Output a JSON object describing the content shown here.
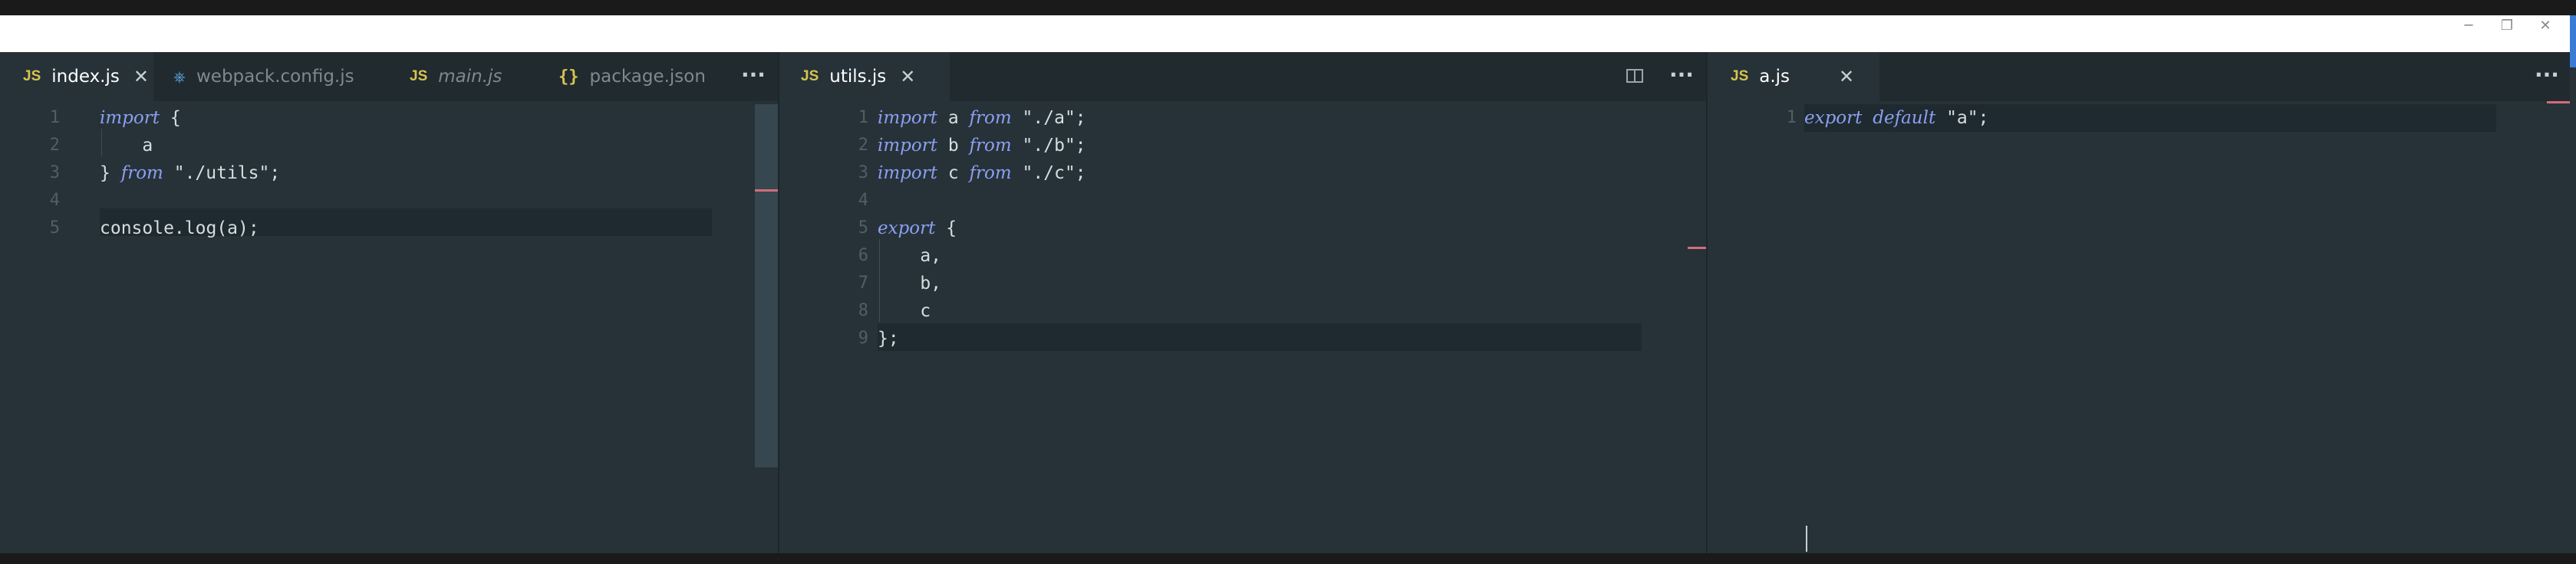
{
  "window": {
    "minimize_glyph": "─",
    "maximize_glyph": "❐",
    "close_glyph": "✕"
  },
  "groups": [
    {
      "tabs": [
        {
          "icon": "JS",
          "label": "index.js",
          "close": "✕",
          "active": true
        },
        {
          "icon": "⎈",
          "label": "webpack.config.js"
        },
        {
          "icon": "JS",
          "label": "main.js",
          "italic": true
        },
        {
          "icon": "{}",
          "label": "package.json"
        }
      ],
      "more": "···",
      "lines": [
        {
          "n": "1",
          "tokens": [
            [
              "kw",
              "import"
            ],
            [
              "pun",
              " {"
            ]
          ]
        },
        {
          "n": "2",
          "tokens": [
            [
              "id",
              "    a"
            ]
          ]
        },
        {
          "n": "3",
          "tokens": [
            [
              "pun",
              "} "
            ],
            [
              "kw",
              "from"
            ],
            [
              "str",
              " \"./utils\""
            ],
            [
              "pun",
              ";"
            ]
          ]
        },
        {
          "n": "4",
          "tokens": []
        },
        {
          "n": "5",
          "tokens": [
            [
              "id",
              "console.log(a)"
            ],
            [
              "pun",
              ";"
            ]
          ]
        }
      ]
    },
    {
      "tabs": [
        {
          "icon": "JS",
          "label": "utils.js",
          "close": "✕",
          "active": true
        }
      ],
      "more": "···",
      "lines": [
        {
          "n": "1",
          "tokens": [
            [
              "kw",
              "import"
            ],
            [
              "id",
              " a "
            ],
            [
              "kw",
              "from"
            ],
            [
              "str",
              " \"./a\""
            ],
            [
              "pun",
              ";"
            ]
          ]
        },
        {
          "n": "2",
          "tokens": [
            [
              "kw",
              "import"
            ],
            [
              "id",
              " b "
            ],
            [
              "kw",
              "from"
            ],
            [
              "str",
              " \"./b\""
            ],
            [
              "pun",
              ";"
            ]
          ]
        },
        {
          "n": "3",
          "tokens": [
            [
              "kw",
              "import"
            ],
            [
              "id",
              " c "
            ],
            [
              "kw",
              "from"
            ],
            [
              "str",
              " \"./c\""
            ],
            [
              "pun",
              ";"
            ]
          ]
        },
        {
          "n": "4",
          "tokens": []
        },
        {
          "n": "5",
          "tokens": [
            [
              "kw",
              "export"
            ],
            [
              "pun",
              " {"
            ]
          ]
        },
        {
          "n": "6",
          "tokens": [
            [
              "id",
              "    a,"
            ]
          ]
        },
        {
          "n": "7",
          "tokens": [
            [
              "id",
              "    b,"
            ]
          ]
        },
        {
          "n": "8",
          "tokens": [
            [
              "id",
              "    c"
            ]
          ]
        },
        {
          "n": "9",
          "tokens": [
            [
              "pun",
              "};"
            ]
          ]
        }
      ]
    },
    {
      "tabs": [
        {
          "icon": "JS",
          "label": "a.js",
          "close": "✕",
          "active": true
        }
      ],
      "more": "···",
      "lines": [
        {
          "n": "1",
          "tokens": [
            [
              "kw",
              "export"
            ],
            [
              "pun",
              " "
            ],
            [
              "kw",
              "default"
            ],
            [
              "str",
              " \"a\""
            ],
            [
              "pun",
              ";"
            ]
          ]
        }
      ]
    }
  ]
}
